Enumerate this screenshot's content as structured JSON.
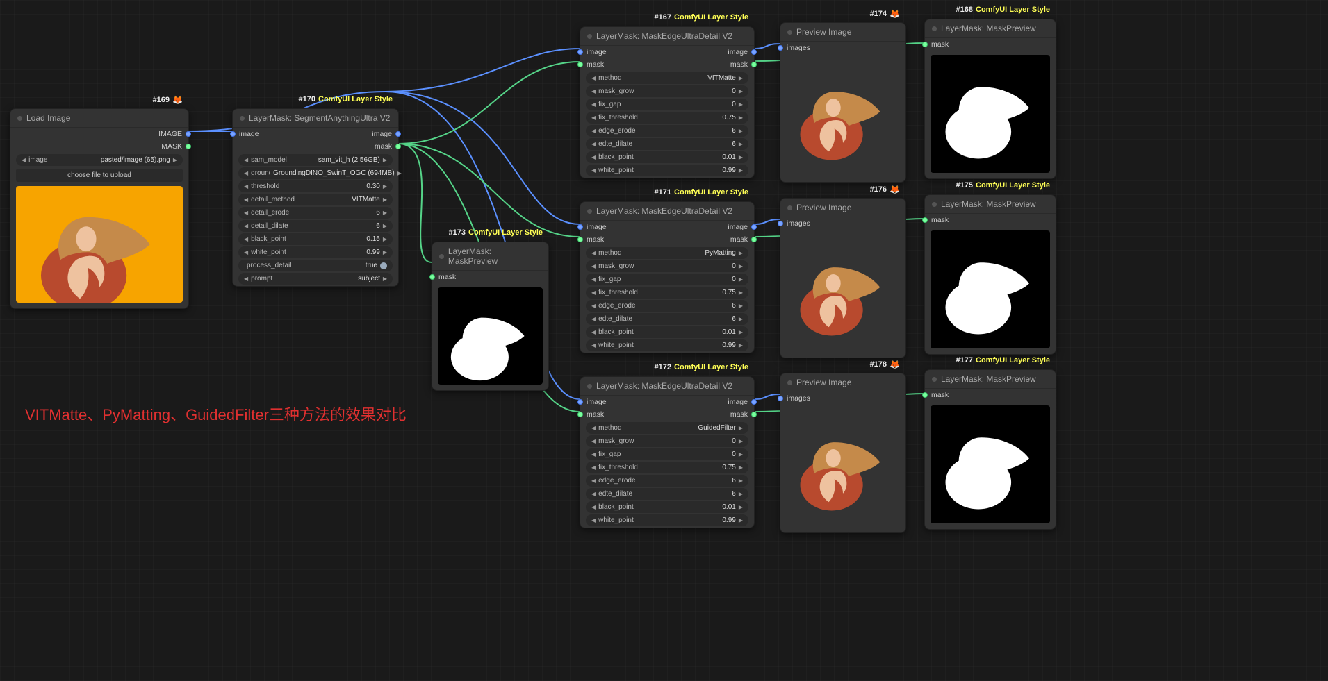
{
  "annot_text": "VITMatte、PyMatting、GuidedFilter三种方法的效果对比",
  "labels": {
    "image_in": "image",
    "mask_in": "mask",
    "images_in": "images",
    "image_out": "image",
    "mask_out": "mask",
    "IMAGE_out": "IMAGE",
    "MASK_out": "MASK"
  },
  "n169": {
    "id": "#169",
    "title": "Load Image",
    "w_img_label": "image",
    "w_img_val": "pasted/image (65).png",
    "upload": "choose file to upload"
  },
  "n170": {
    "id": "#170",
    "sub": "ComfyUI Layer Style",
    "title": "LayerMask: SegmentAnythingUltra V2",
    "w": [
      {
        "l": "sam_model",
        "v": "sam_vit_h (2.56GB)"
      },
      {
        "l": "grounding_dino_model",
        "v": "GroundingDINO_SwinT_OGC (694MB)",
        "overlap": true
      },
      {
        "l": "threshold",
        "v": "0.30"
      },
      {
        "l": "detail_method",
        "v": "VITMatte"
      },
      {
        "l": "detail_erode",
        "v": "6"
      },
      {
        "l": "detail_dilate",
        "v": "6"
      },
      {
        "l": "black_point",
        "v": "0.15"
      },
      {
        "l": "white_point",
        "v": "0.99"
      },
      {
        "l": "process_detail",
        "v": "true",
        "toggle": true
      },
      {
        "l": "prompt",
        "v": "subject"
      }
    ]
  },
  "n173": {
    "id": "#173",
    "sub": "ComfyUI Layer Style",
    "title": "LayerMask: MaskPreview"
  },
  "n167": {
    "id": "#167",
    "sub": "ComfyUI Layer Style",
    "title": "LayerMask: MaskEdgeUltraDetail V2",
    "w": [
      {
        "l": "method",
        "v": "VITMatte"
      },
      {
        "l": "mask_grow",
        "v": "0"
      },
      {
        "l": "fix_gap",
        "v": "0"
      },
      {
        "l": "fix_threshold",
        "v": "0.75"
      },
      {
        "l": "edge_erode",
        "v": "6"
      },
      {
        "l": "edte_dilate",
        "v": "6"
      },
      {
        "l": "black_point",
        "v": "0.01"
      },
      {
        "l": "white_point",
        "v": "0.99"
      }
    ]
  },
  "n171": {
    "id": "#171",
    "sub": "ComfyUI Layer Style",
    "title": "LayerMask: MaskEdgeUltraDetail V2",
    "w": [
      {
        "l": "method",
        "v": "PyMatting"
      },
      {
        "l": "mask_grow",
        "v": "0"
      },
      {
        "l": "fix_gap",
        "v": "0"
      },
      {
        "l": "fix_threshold",
        "v": "0.75"
      },
      {
        "l": "edge_erode",
        "v": "6"
      },
      {
        "l": "edte_dilate",
        "v": "6"
      },
      {
        "l": "black_point",
        "v": "0.01"
      },
      {
        "l": "white_point",
        "v": "0.99"
      }
    ]
  },
  "n172": {
    "id": "#172",
    "sub": "ComfyUI Layer Style",
    "title": "LayerMask: MaskEdgeUltraDetail V2",
    "w": [
      {
        "l": "method",
        "v": "GuidedFilter"
      },
      {
        "l": "mask_grow",
        "v": "0"
      },
      {
        "l": "fix_gap",
        "v": "0"
      },
      {
        "l": "fix_threshold",
        "v": "0.75"
      },
      {
        "l": "edge_erode",
        "v": "6"
      },
      {
        "l": "edte_dilate",
        "v": "6"
      },
      {
        "l": "black_point",
        "v": "0.01"
      },
      {
        "l": "white_point",
        "v": "0.99"
      }
    ]
  },
  "n174": {
    "id": "#174",
    "title": "Preview Image"
  },
  "n176": {
    "id": "#176",
    "title": "Preview Image"
  },
  "n178": {
    "id": "#178",
    "title": "Preview Image"
  },
  "n168": {
    "id": "#168",
    "sub": "ComfyUI Layer Style",
    "title": "LayerMask: MaskPreview"
  },
  "n175": {
    "id": "#175",
    "sub": "ComfyUI Layer Style",
    "title": "LayerMask: MaskPreview"
  },
  "n177": {
    "id": "#177",
    "sub": "ComfyUI Layer Style",
    "title": "LayerMask: MaskPreview"
  }
}
